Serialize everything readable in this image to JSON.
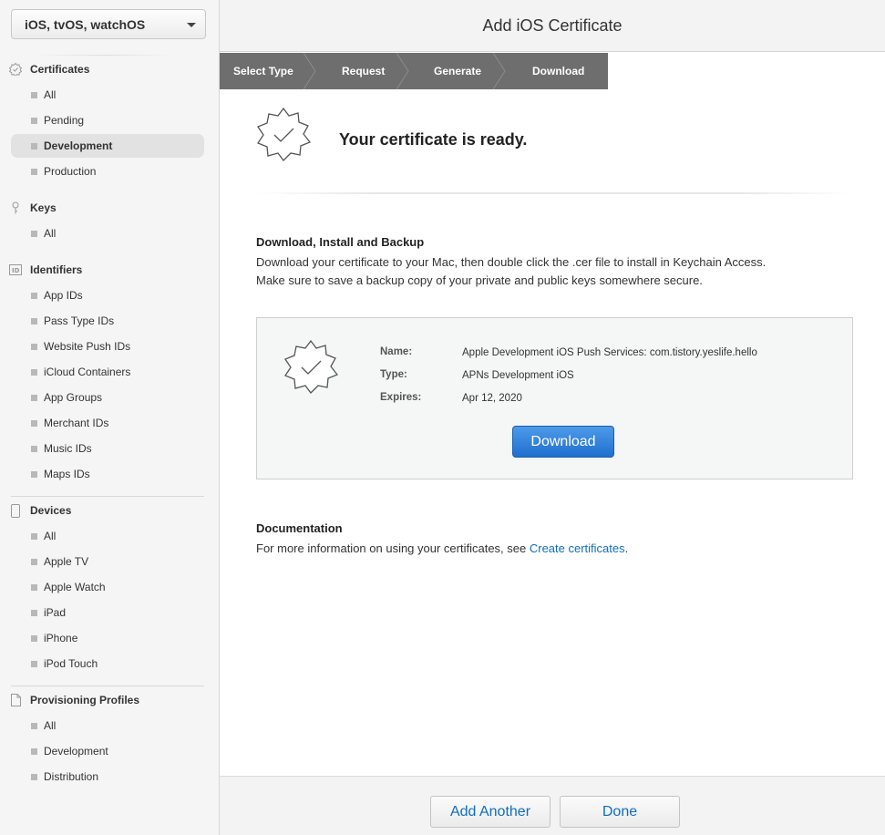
{
  "sidebar": {
    "platform_select": "iOS, tvOS, watchOS",
    "sections": [
      {
        "title": "Certificates",
        "icon": "badge-icon",
        "items": [
          "All",
          "Pending",
          "Development",
          "Production"
        ],
        "active_index": 2
      },
      {
        "title": "Keys",
        "icon": "key-icon",
        "items": [
          "All"
        ]
      },
      {
        "title": "Identifiers",
        "icon": "id-icon",
        "items": [
          "App IDs",
          "Pass Type IDs",
          "Website Push IDs",
          "iCloud Containers",
          "App Groups",
          "Merchant IDs",
          "Music IDs",
          "Maps IDs"
        ]
      },
      {
        "title": "Devices",
        "icon": "device-icon",
        "items": [
          "All",
          "Apple TV",
          "Apple Watch",
          "iPad",
          "iPhone",
          "iPod Touch"
        ]
      },
      {
        "title": "Provisioning Profiles",
        "icon": "document-icon",
        "items": [
          "All",
          "Development",
          "Distribution"
        ]
      }
    ]
  },
  "header": {
    "title": "Add iOS Certificate"
  },
  "steps": [
    "Select Type",
    "Request",
    "Generate",
    "Download"
  ],
  "ready": {
    "title": "Your certificate is ready."
  },
  "download_section": {
    "title": "Download, Install and Backup",
    "line1": "Download your certificate to your Mac, then double click the .cer file to install in Keychain Access.",
    "line2": "Make sure to save a backup copy of your private and public keys somewhere secure."
  },
  "certificate": {
    "name_label": "Name:",
    "name_value": "Apple Development iOS Push Services: com.tistory.yeslife.hello",
    "type_label": "Type:",
    "type_value": "APNs Development iOS",
    "expires_label": "Expires:",
    "expires_value": "Apr 12, 2020",
    "download_label": "Download"
  },
  "documentation": {
    "title": "Documentation",
    "text": "For more information on using your certificates, see ",
    "link": "Create certificates",
    "suffix": "."
  },
  "footer": {
    "add_another": "Add Another",
    "done": "Done"
  },
  "colors": {
    "link": "#0e6fbd",
    "primary_button": "#1f6fd0",
    "step_bar": "#6e6e6e"
  }
}
